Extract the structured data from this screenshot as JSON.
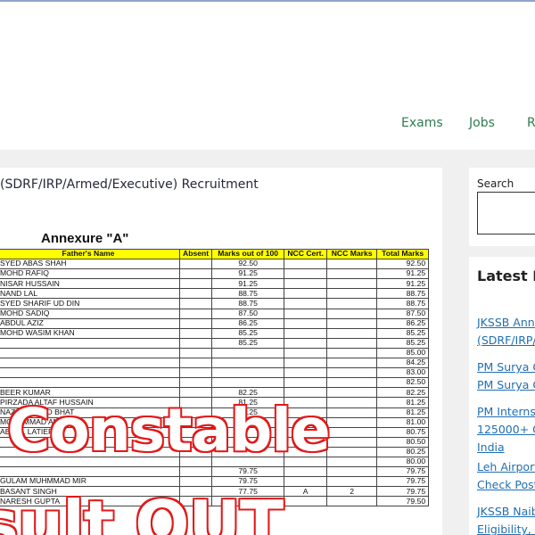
{
  "nav": {
    "items": [
      "Exams",
      "Jobs",
      "R"
    ]
  },
  "article": {
    "title": "(SDRF/IRP/Armed/Executive) Recruitment",
    "image": {
      "annexure": "Annexure \"A\"",
      "columns": [
        "Father's Name",
        "Absent",
        "Marks out of 100",
        "NCC Cert.",
        "NCC Marks",
        "Total Marks"
      ],
      "rows": [
        {
          "name": "SYED ABAS SHAH",
          "absent": "",
          "marks": "92.50",
          "ncc_cert": "",
          "ncc_marks": "",
          "total": "92.50"
        },
        {
          "name": "MOHD RAFIQ",
          "absent": "",
          "marks": "91.25",
          "ncc_cert": "",
          "ncc_marks": "",
          "total": "91.25"
        },
        {
          "name": "NISAR HUSSAIN",
          "absent": "",
          "marks": "91.25",
          "ncc_cert": "",
          "ncc_marks": "",
          "total": "91.25"
        },
        {
          "name": "NAND LAL",
          "absent": "",
          "marks": "88.75",
          "ncc_cert": "",
          "ncc_marks": "",
          "total": "88.75"
        },
        {
          "name": "SYED SHARIF UD DIN",
          "absent": "",
          "marks": "88.75",
          "ncc_cert": "",
          "ncc_marks": "",
          "total": "88.75"
        },
        {
          "name": "MOHD SADIQ",
          "absent": "",
          "marks": "87.50",
          "ncc_cert": "",
          "ncc_marks": "",
          "total": "87.50"
        },
        {
          "name": "ABDUL AZIZ",
          "absent": "",
          "marks": "86.25",
          "ncc_cert": "",
          "ncc_marks": "",
          "total": "86.25"
        },
        {
          "name": "MOHD WASIM KHAN",
          "absent": "",
          "marks": "85.25",
          "ncc_cert": "",
          "ncc_marks": "",
          "total": "85.25"
        },
        {
          "name": "",
          "absent": "",
          "marks": "85.25",
          "ncc_cert": "",
          "ncc_marks": "",
          "total": "85.25"
        },
        {
          "name": "",
          "absent": "",
          "marks": "",
          "ncc_cert": "",
          "ncc_marks": "",
          "total": "85.00"
        },
        {
          "name": "",
          "absent": "",
          "marks": "",
          "ncc_cert": "",
          "ncc_marks": "",
          "total": "84.25"
        },
        {
          "name": "",
          "absent": "",
          "marks": "",
          "ncc_cert": "",
          "ncc_marks": "",
          "total": "83.00"
        },
        {
          "name": "",
          "absent": "",
          "marks": "",
          "ncc_cert": "",
          "ncc_marks": "",
          "total": "82.50"
        },
        {
          "name": "BEER KUMAR",
          "absent": "",
          "marks": "82.25",
          "ncc_cert": "",
          "ncc_marks": "",
          "total": "82.25"
        },
        {
          "name": "PIRZADA ALTAF HUSSAIN",
          "absent": "",
          "marks": "81.25",
          "ncc_cert": "",
          "ncc_marks": "",
          "total": "81.25"
        },
        {
          "name": "NAZIR AHMAD BHAT",
          "absent": "",
          "marks": "81.25",
          "ncc_cert": "",
          "ncc_marks": "",
          "total": "81.25"
        },
        {
          "name": "MOHAMMAD AM",
          "absent": "",
          "marks": "81.00",
          "ncc_cert": "",
          "ncc_marks": "",
          "total": "81.00"
        },
        {
          "name": "ABDUL LATIEF",
          "absent": "",
          "marks": "",
          "ncc_cert": "",
          "ncc_marks": "",
          "total": "80.75"
        },
        {
          "name": "",
          "absent": "",
          "marks": "",
          "ncc_cert": "",
          "ncc_marks": "",
          "total": "80.50"
        },
        {
          "name": "",
          "absent": "",
          "marks": "",
          "ncc_cert": "",
          "ncc_marks": "",
          "total": "80.25"
        },
        {
          "name": "",
          "absent": "",
          "marks": "",
          "ncc_cert": "",
          "ncc_marks": "",
          "total": "80.00"
        },
        {
          "name": "",
          "absent": "",
          "marks": "79.75",
          "ncc_cert": "",
          "ncc_marks": "",
          "total": "79.75"
        },
        {
          "name": "GULAM MUHMMAD MIR",
          "absent": "",
          "marks": "79.75",
          "ncc_cert": "",
          "ncc_marks": "",
          "total": "79.75"
        },
        {
          "name": "BASANT SINGH",
          "absent": "",
          "marks": "77.75",
          "ncc_cert": "A",
          "ncc_marks": "2",
          "total": "79.75"
        },
        {
          "name": "NARESH GUPTA",
          "absent": "",
          "marks": "79.50",
          "ncc_cert": "",
          "ncc_marks": "",
          "total": "79.50"
        }
      ],
      "overlay_line1": "Constable",
      "overlay_line2": "sult OUT"
    }
  },
  "search": {
    "label": "Search"
  },
  "latest": {
    "title": "Latest P",
    "posts": [
      [
        "JKSSB Anno",
        "(SDRF/IRP/"
      ],
      [
        "PM Surya G",
        "PM Surya G"
      ],
      [
        "PM Internsh",
        "125000+ O",
        "India"
      ],
      [
        "Leh Airport",
        "Check Post"
      ],
      [
        "JKSSB Naib",
        "Eligibility, E"
      ]
    ]
  }
}
